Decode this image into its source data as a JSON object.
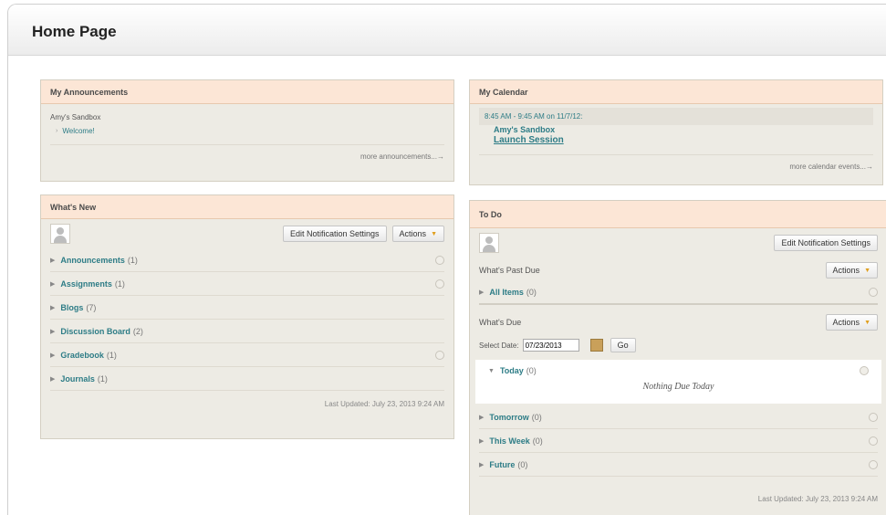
{
  "page": {
    "title": "Home Page"
  },
  "announcements": {
    "title": "My Announcements",
    "course": "Amy's Sandbox",
    "item": "Welcome!",
    "more": "more announcements...→"
  },
  "calendar": {
    "title": "My Calendar",
    "time": "8:45 AM - 9:45 AM on 11/7/12:",
    "course": "Amy's Sandbox",
    "event": "Launch Session",
    "more": "more calendar events...→"
  },
  "whats_new": {
    "title": "What's New",
    "edit_button": "Edit Notification Settings",
    "actions_button": "Actions",
    "items": [
      {
        "label": "Announcements",
        "count": "(1)"
      },
      {
        "label": "Assignments",
        "count": "(1)"
      },
      {
        "label": "Blogs",
        "count": "(7)"
      },
      {
        "label": "Discussion Board",
        "count": "(2)"
      },
      {
        "label": "Gradebook",
        "count": "(1)"
      },
      {
        "label": "Journals",
        "count": "(1)"
      }
    ],
    "updated": "Last Updated: July 23, 2013 9:24 AM"
  },
  "todo": {
    "title": "To Do",
    "edit_button": "Edit Notification Settings",
    "past_due": {
      "label": "What's Past Due",
      "actions_button": "Actions",
      "item": {
        "label": "All Items",
        "count": "(0)"
      }
    },
    "due": {
      "label": "What's Due",
      "actions_button": "Actions",
      "select_label": "Select Date:",
      "date_value": "07/23/2013",
      "go_button": "Go",
      "today": {
        "label": "Today",
        "count": "(0)"
      },
      "nothing_due": "Nothing Due Today",
      "items": [
        {
          "label": "Tomorrow",
          "count": "(0)"
        },
        {
          "label": "This Week",
          "count": "(0)"
        },
        {
          "label": "Future",
          "count": "(0)"
        }
      ]
    },
    "updated": "Last Updated: July 23, 2013 9:24 AM"
  }
}
